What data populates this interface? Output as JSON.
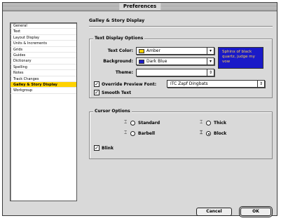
{
  "window": {
    "title": "Preferences"
  },
  "sidebar": {
    "items": [
      {
        "label": "General"
      },
      {
        "label": "Text"
      },
      {
        "label": "Layout Display"
      },
      {
        "label": "Units & Increments"
      },
      {
        "label": "Grids"
      },
      {
        "label": "Guides"
      },
      {
        "label": "Dictionary"
      },
      {
        "label": "Spelling"
      },
      {
        "label": "Notes"
      },
      {
        "label": "Track Changes"
      },
      {
        "label": "Galley & Story Display"
      },
      {
        "label": "Workgroup"
      }
    ],
    "selected_index": 10
  },
  "panel": {
    "title": "Galley & Story Display",
    "text_display": {
      "title": "Text Display Options",
      "text_color_label": "Text Color:",
      "text_color_value": "Amber",
      "text_color_swatch": "#ffd200",
      "background_label": "Background:",
      "background_value": "Dark Blue",
      "background_swatch": "#1a1ac8",
      "theme_label": "Theme:",
      "theme_value": "",
      "preview_text": "Sphinx of black quartz, judge my vow",
      "override_label": "Override Preview Font:",
      "override_checked": true,
      "font_value": "ITC Zapf Dingbats",
      "smooth_label": "Smooth Text",
      "smooth_checked": true
    },
    "cursor_options": {
      "title": "Cursor Options",
      "standard_label": "Standard",
      "barbell_label": "Barbell",
      "thick_label": "Thick",
      "block_label": "Block",
      "selected": "Block",
      "blink_label": "Blink",
      "blink_checked": true
    }
  },
  "buttons": {
    "cancel": "Cancel",
    "ok": "OK"
  },
  "icons": {
    "popup_arrow": "chevron-down-icon",
    "stepper": "stepper-icon",
    "checkmark": "checkmark-icon",
    "cursor": "text-cursor-icon"
  }
}
